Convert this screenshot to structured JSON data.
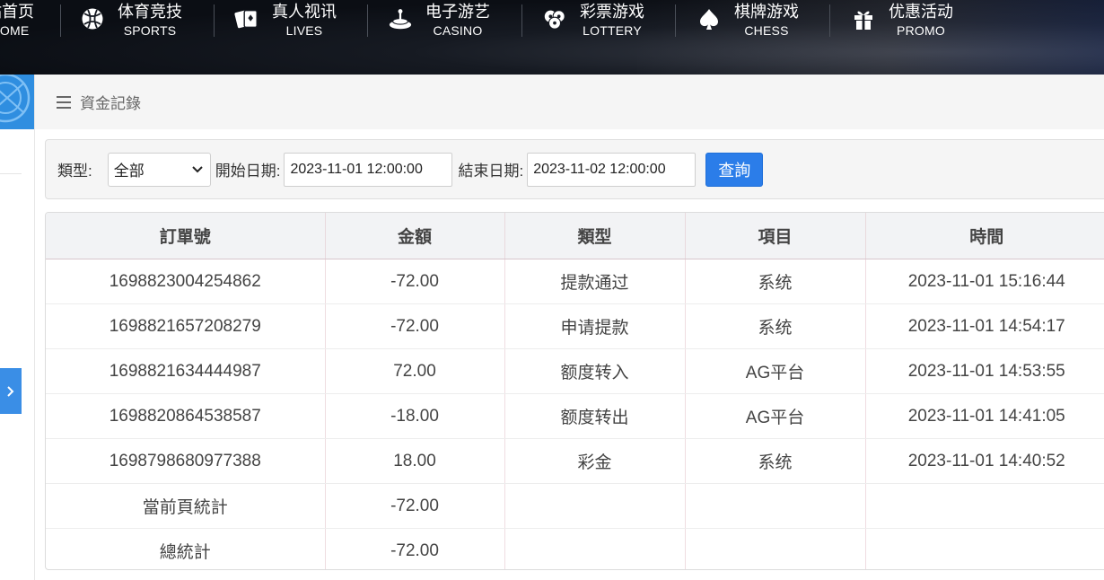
{
  "nav": {
    "items": [
      {
        "zh": "站首页",
        "en": "HOME",
        "icon": "home-icon"
      },
      {
        "zh": "体育竞技",
        "en": "SPORTS",
        "icon": "sports-ball-icon"
      },
      {
        "zh": "真人视讯",
        "en": "LIVES",
        "icon": "playing-cards-icon"
      },
      {
        "zh": "电子游艺",
        "en": "CASINO",
        "icon": "roulette-icon"
      },
      {
        "zh": "彩票游戏",
        "en": "LOTTERY",
        "icon": "lottery-balls-icon"
      },
      {
        "zh": "棋牌游戏",
        "en": "CHESS",
        "icon": "spade-icon"
      },
      {
        "zh": "优惠活动",
        "en": "PROMO",
        "icon": "gift-icon"
      }
    ]
  },
  "breadcrumb": {
    "title": "資金記錄"
  },
  "filter": {
    "type_label": "類型:",
    "type_value": "全部",
    "start_label": "開始日期:",
    "start_value": "2023-11-01 12:00:00",
    "end_label": "結束日期:",
    "end_value": "2023-11-02 12:00:00",
    "query_label": "查詢"
  },
  "table": {
    "headers": [
      "訂單號",
      "金額",
      "類型",
      "項目",
      "時間"
    ],
    "rows": [
      [
        "1698823004254862",
        "-72.00",
        "提款通过",
        "系统",
        "2023-11-01 15:16:44"
      ],
      [
        "1698821657208279",
        "-72.00",
        "申请提款",
        "系统",
        "2023-11-01 14:54:17"
      ],
      [
        "1698821634444987",
        "72.00",
        "额度转入",
        "AG平台",
        "2023-11-01 14:53:55"
      ],
      [
        "1698820864538587",
        "-18.00",
        "额度转出",
        "AG平台",
        "2023-11-01 14:41:05"
      ],
      [
        "1698798680977388",
        "18.00",
        "彩金",
        "系统",
        "2023-11-01 14:40:52"
      ]
    ],
    "page_total_label": "當前頁統計",
    "page_total_value": "-72.00",
    "grand_total_label": "總統計",
    "grand_total_value": "-72.00"
  },
  "colors": {
    "accent": "#2b7de9",
    "nav_bg": "#0d1016",
    "sidebar_accent": "#2f8ee0"
  }
}
